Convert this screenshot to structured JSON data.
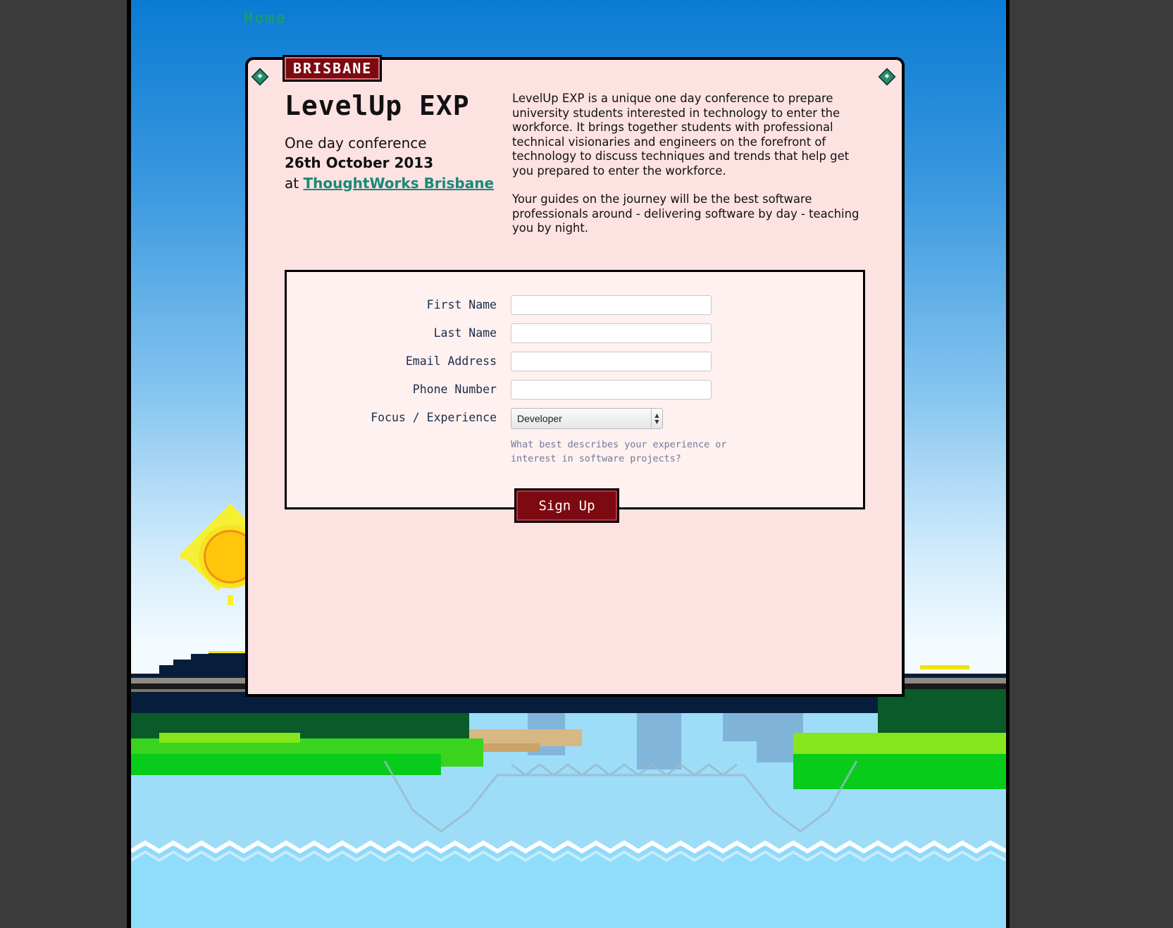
{
  "nav": {
    "home_label": "Home"
  },
  "event": {
    "city_tag": "BRISBANE",
    "title": "LevelUp EXP",
    "subtitle": "One day conference",
    "date": "26th October 2013",
    "venue_prefix": "at",
    "venue_link": "ThoughtWorks Brisbane",
    "description": [
      "LevelUp EXP is a unique one day conference to prepare university students interested in technology to enter the workforce. It brings together students with professional technical visionaries and engineers on the forefront of technology to discuss techniques and trends that help get you prepared to enter the workforce.",
      "Your guides on the journey will be the best software professionals around - delivering software by day - teaching you by night."
    ]
  },
  "form": {
    "first_name_label": "First Name",
    "first_name_value": "",
    "last_name_label": "Last Name",
    "last_name_value": "",
    "email_label": "Email Address",
    "email_value": "",
    "phone_label": "Phone Number",
    "phone_value": "",
    "focus_label": "Focus / Experience",
    "focus_selected": "Developer",
    "hint": "What best describes your experience or interest in software projects?",
    "submit_label": "Sign Up"
  },
  "colors": {
    "accent": "#7d0a12",
    "link": "#178a76",
    "card_background": "#fde2e2",
    "sky_top": "#0a7bd3",
    "water": "#8fd9fb"
  },
  "icons": [
    "gem-corner-icon",
    "select-arrows-icon"
  ]
}
